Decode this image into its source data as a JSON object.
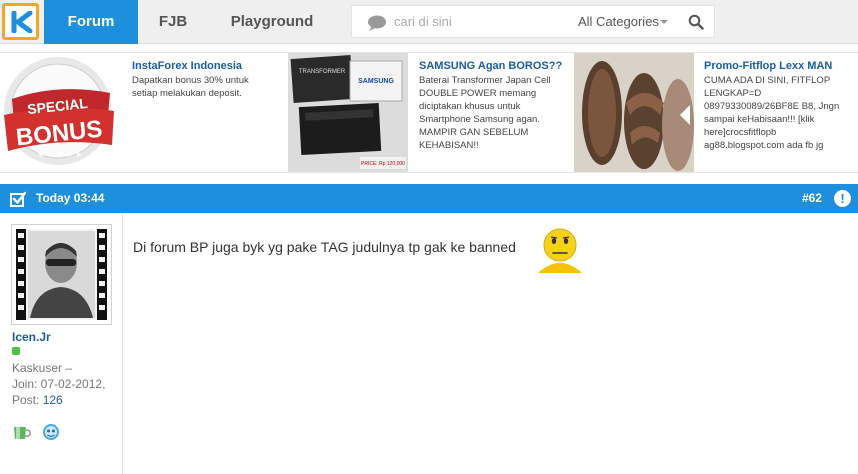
{
  "nav": {
    "tabs": [
      {
        "label": "Forum",
        "active": true
      },
      {
        "label": "FJB",
        "active": false
      },
      {
        "label": "Playground",
        "active": false
      }
    ]
  },
  "search": {
    "placeholder": "cari di sini",
    "category": "All Categories"
  },
  "ads": [
    {
      "title": "InstaForex Indonesia",
      "desc": "Dapatkan bonus 30% untuk setiap melakukan deposit.",
      "image_text": [
        "SPECIAL",
        "BONUS"
      ]
    },
    {
      "title": "SAMSUNG Agan BOROS??",
      "desc": "Baterai Transformer Japan Cell DOUBLE POWER memang diciptakan khusus untuk Smartphone Samsung agan. MAMPIR GAN SEBELUM KEHABISAN!!",
      "image_text": [
        "TRANSFORMER",
        "SAMSUNG",
        "PRICE: Rp 120,000"
      ]
    },
    {
      "title": "Promo-Fitflop Lexx MAN",
      "desc": "CUMA ADA DI SINI, FITFLOP LENGKAP=D 08979330089/26BF8E B8, Jngn sampai keHabisaan!!! [klik here]crocsfitflopb ag88.blogspot.com ada fb jg"
    }
  ],
  "post": {
    "time": "Today 03:44",
    "number": "#62",
    "message": "Di forum BP juga byk yg pake TAG judulnya tp gak ke banned",
    "user": {
      "name": "Icen.Jr",
      "rank": "Kaskuser –",
      "join": "Join: 07-02-2012,",
      "post_label": "Post: ",
      "post_count": "126"
    }
  },
  "colors": {
    "accent": "#1e8fdc",
    "logo_border": "#f5a623",
    "link": "#1a5dab",
    "online": "#4cc14c"
  },
  "icons": [
    "kaskus-logo-icon",
    "chat-bubble-icon",
    "search-icon",
    "checkbox-icon",
    "exclamation-icon",
    "online-status-icon",
    "cup-badge-icon",
    "emoticon-badge-icon",
    "sad-smiley-icon"
  ]
}
